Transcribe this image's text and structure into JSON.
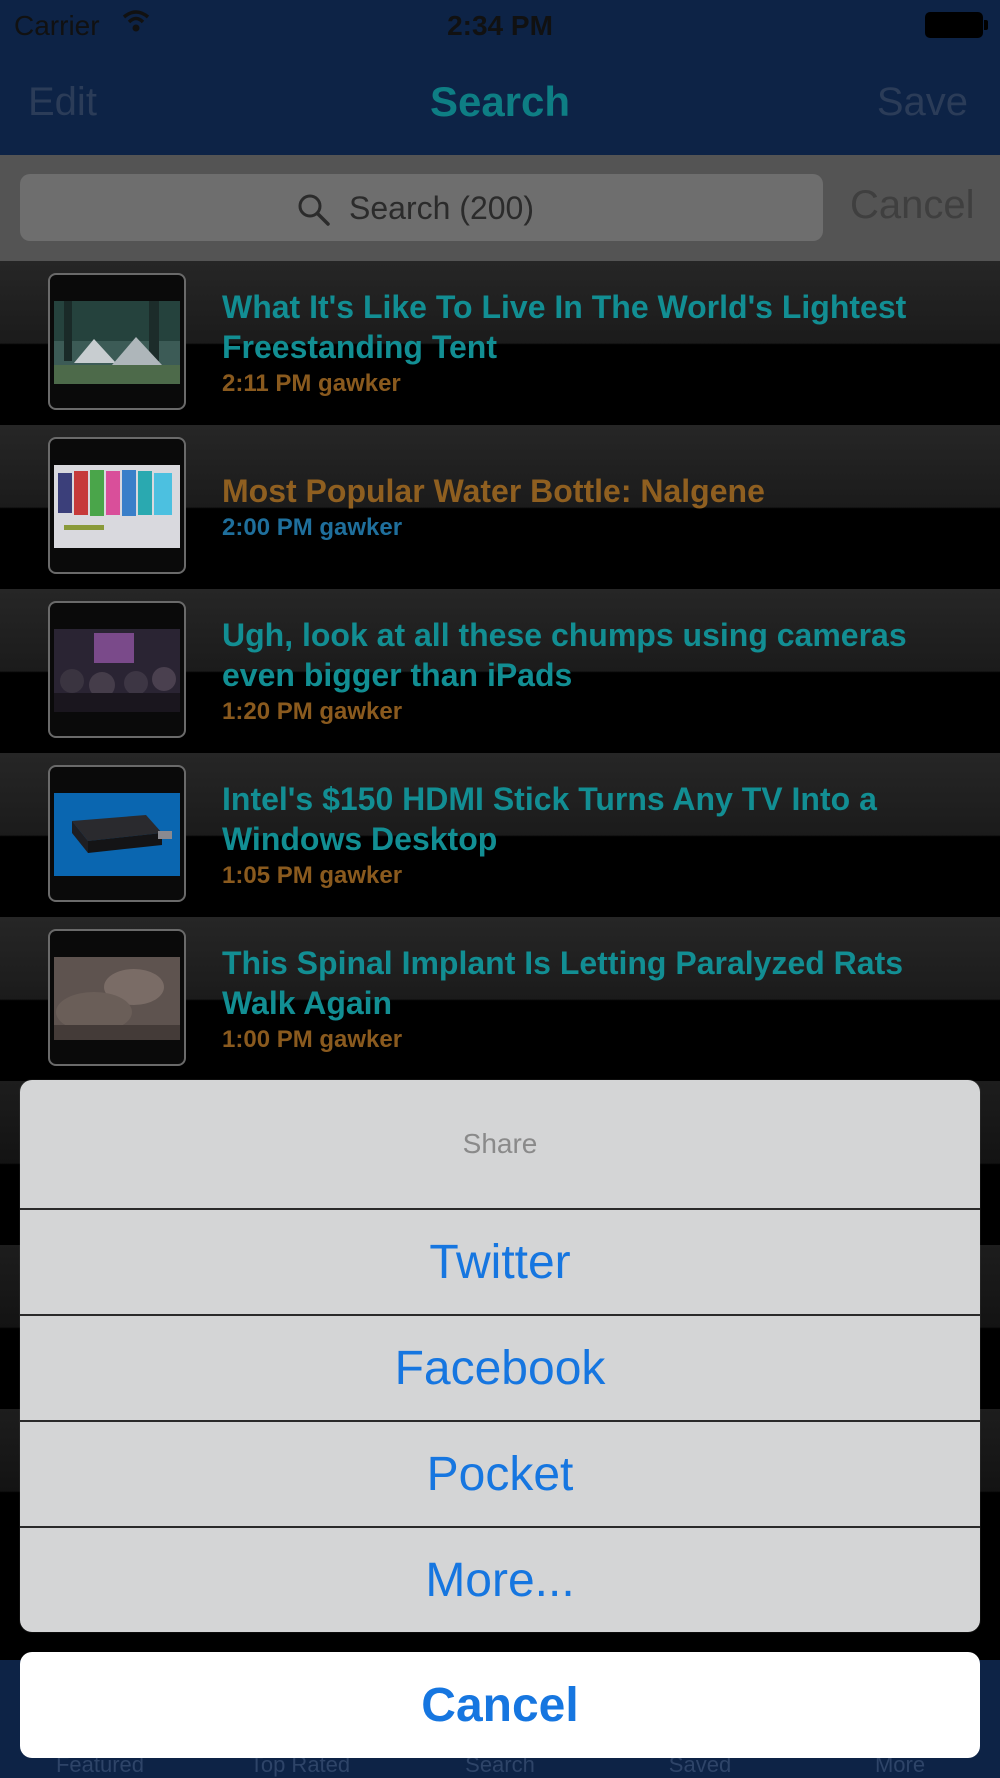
{
  "status_bar": {
    "carrier": "Carrier",
    "time": "2:34 PM"
  },
  "nav": {
    "edit": "Edit",
    "title": "Search",
    "save": "Save"
  },
  "search": {
    "placeholder": "Search (200)",
    "cancel": "Cancel"
  },
  "colors": {
    "title_teal": "#128e93",
    "meta_orange": "#8a5a1e",
    "meta_blue": "#1f6f9c",
    "headline_orange": "#8f5f20",
    "action_blue": "#1676e0"
  },
  "articles": [
    {
      "title": "What It's Like To Live In The World's Lightest Freestanding Tent",
      "meta": "2:11 PM gawker",
      "title_color": "#128e93",
      "meta_color": "#8a5a1e"
    },
    {
      "title": "Most Popular Water Bottle: Nalgene",
      "meta": "2:00 PM gawker",
      "title_color": "#8f5f20",
      "meta_color": "#1f6f9c"
    },
    {
      "title": "Ugh, look at all these chumps using cameras even bigger than iPads",
      "meta": "1:20 PM gawker",
      "title_color": "#128e93",
      "meta_color": "#8a5a1e"
    },
    {
      "title": "Intel's $150 HDMI Stick Turns Any TV Into a Windows Desktop",
      "meta": "1:05 PM gawker",
      "title_color": "#128e93",
      "meta_color": "#8a5a1e"
    },
    {
      "title": "This Spinal Implant Is Letting Paralyzed Rats Walk Again",
      "meta": "1:00 PM gawker",
      "title_color": "#128e93",
      "meta_color": "#8a5a1e"
    }
  ],
  "tabs": [
    "Featured",
    "Top Rated",
    "Search",
    "Saved",
    "More"
  ],
  "action_sheet": {
    "title": "Share",
    "options": [
      "Twitter",
      "Facebook",
      "Pocket",
      "More..."
    ],
    "cancel": "Cancel"
  }
}
